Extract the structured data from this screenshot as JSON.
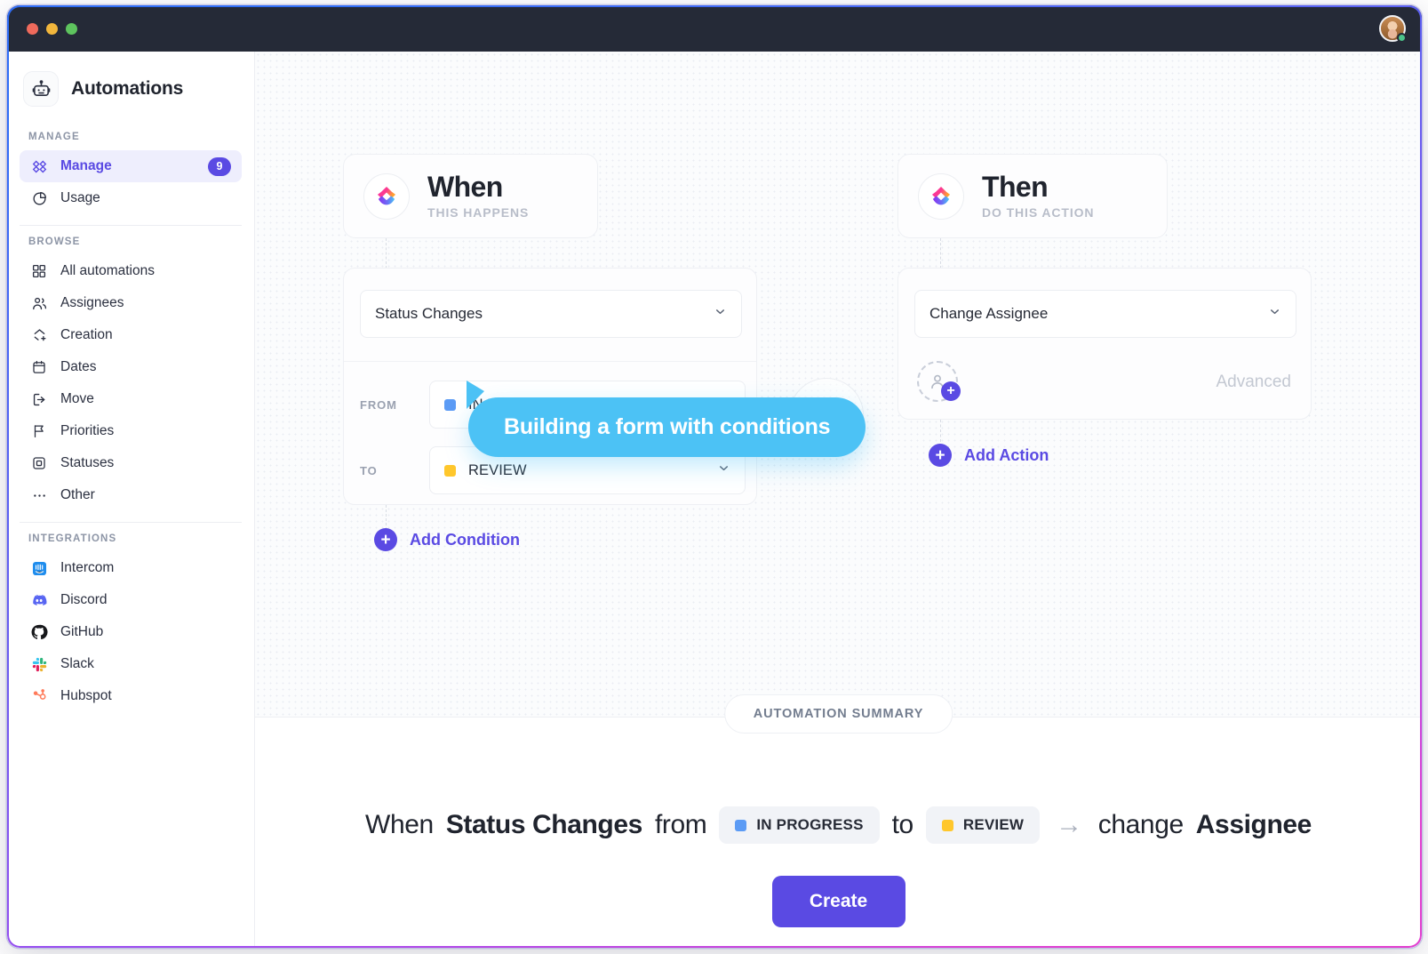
{
  "window": {
    "traffic_lights": [
      "close",
      "minimize",
      "maximize"
    ],
    "accent_gradient": [
      "#2f6df6",
      "#6b5bf0",
      "#e23fd0"
    ]
  },
  "sidebar": {
    "brand": {
      "title": "Automations",
      "icon": "robot-icon"
    },
    "sections": [
      {
        "label": "MANAGE",
        "items": [
          {
            "label": "Manage",
            "icon": "flows-icon",
            "badge": "9",
            "active": true
          },
          {
            "label": "Usage",
            "icon": "pie-chart-icon",
            "badge": "",
            "active": false
          }
        ]
      },
      {
        "label": "BROWSE",
        "items": [
          {
            "label": "All automations",
            "icon": "grid-icon",
            "badge": "",
            "active": false
          },
          {
            "label": "Assignees",
            "icon": "people-icon",
            "badge": "",
            "active": false
          },
          {
            "label": "Creation",
            "icon": "create-icon",
            "badge": "",
            "active": false
          },
          {
            "label": "Dates",
            "icon": "calendar-icon",
            "badge": "",
            "active": false
          },
          {
            "label": "Move",
            "icon": "move-out-icon",
            "badge": "",
            "active": false
          },
          {
            "label": "Priorities",
            "icon": "flag-icon",
            "badge": "",
            "active": false
          },
          {
            "label": "Statuses",
            "icon": "square-in-square-icon",
            "badge": "",
            "active": false
          },
          {
            "label": "Other",
            "icon": "ellipsis-icon",
            "badge": "",
            "active": false
          }
        ]
      },
      {
        "label": "INTEGRATIONS",
        "items": [
          {
            "label": "Intercom",
            "icon": "intercom-icon",
            "badge": "",
            "active": false
          },
          {
            "label": "Discord",
            "icon": "discord-icon",
            "badge": "",
            "active": false
          },
          {
            "label": "GitHub",
            "icon": "github-icon",
            "badge": "",
            "active": false
          },
          {
            "label": "Slack",
            "icon": "slack-icon",
            "badge": "",
            "active": false
          },
          {
            "label": "Hubspot",
            "icon": "hubspot-icon",
            "badge": "",
            "active": false
          }
        ]
      }
    ]
  },
  "builder": {
    "when": {
      "title": "When",
      "subtitle": "THIS HAPPENS",
      "trigger": "Status Changes",
      "from_label": "FROM",
      "from_value": "IN PROGRESS",
      "from_color": "#5b9bf5",
      "to_label": "TO",
      "to_value": "REVIEW",
      "to_color": "#ffc72c",
      "add_condition": "Add Condition"
    },
    "then": {
      "title": "Then",
      "subtitle": "DO THIS ACTION",
      "action": "Change Assignee",
      "advanced": "Advanced",
      "add_action": "Add Action"
    },
    "flow_arrow": "arrow-right-icon"
  },
  "tooltip": {
    "text": "Building a form with conditions",
    "color": "#4cc2f5"
  },
  "summary": {
    "pill": "AUTOMATION SUMMARY",
    "when_word": "When",
    "trigger": "Status Changes",
    "from_word": "from",
    "from_value": "IN PROGRESS",
    "from_color": "#5b9bf5",
    "to_word": "to",
    "to_value": "REVIEW",
    "to_color": "#ffc72c",
    "arrow": "→",
    "change_word": "change",
    "action_target": "Assignee",
    "create_button": "Create"
  }
}
